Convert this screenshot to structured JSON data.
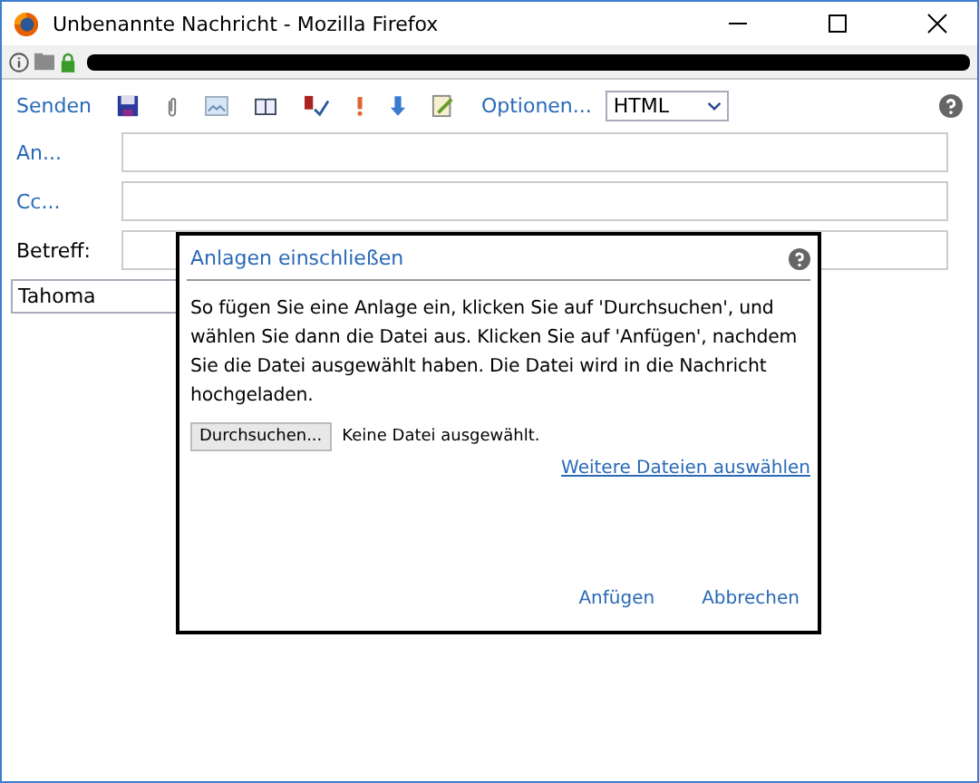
{
  "window": {
    "title": "Unbenannte Nachricht - Mozilla Firefox"
  },
  "toolbar": {
    "send": "Senden",
    "options": "Optionen...",
    "format": "HTML"
  },
  "fields": [
    {
      "label": "An...",
      "kind": "link"
    },
    {
      "label": "Cc...",
      "kind": "link"
    },
    {
      "label": "Betreff:",
      "kind": "plain"
    }
  ],
  "font_select": "Tahoma",
  "dialog": {
    "title": "Anlagen einschließen",
    "text": "So fügen Sie eine Anlage ein, klicken Sie auf 'Durchsuchen', und wählen Sie dann die Datei aus. Klicken Sie auf 'Anfügen', nachdem Sie die Datei ausgewählt haben. Die Datei wird in die Nachricht hochgeladen.",
    "browse_button": "Durchsuchen...",
    "file_status": "Keine Datei ausgewählt.",
    "more_link": "Weitere Dateien auswählen",
    "buttons": [
      "Anfügen",
      "Abbrechen"
    ]
  }
}
